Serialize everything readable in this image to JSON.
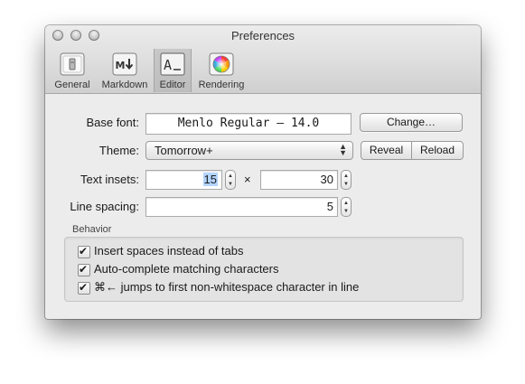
{
  "window": {
    "title": "Preferences"
  },
  "toolbar": {
    "tabs": [
      {
        "label": "General",
        "icon": "switch-icon"
      },
      {
        "label": "Markdown",
        "icon": "markdown-icon"
      },
      {
        "label": "Editor",
        "icon": "editor-icon",
        "active": true
      },
      {
        "label": "Rendering",
        "icon": "color-wheel-icon"
      }
    ]
  },
  "editor": {
    "base_font": {
      "label": "Base font:",
      "value": "Menlo Regular – 14.0",
      "change_button": "Change…"
    },
    "theme": {
      "label": "Theme:",
      "value": "Tomorrow+",
      "reveal_button": "Reveal",
      "reload_button": "Reload"
    },
    "text_insets": {
      "label": "Text insets:",
      "horizontal": "15",
      "separator": "×",
      "vertical": "30"
    },
    "line_spacing": {
      "label": "Line spacing:",
      "value": "5"
    },
    "behavior": {
      "title": "Behavior",
      "options": [
        {
          "label": "Insert spaces instead of tabs",
          "checked": true
        },
        {
          "label": "Auto-complete matching characters",
          "checked": true
        },
        {
          "label": "⌘← jumps to first non-whitespace character in line",
          "checked": true
        }
      ]
    }
  },
  "colors": {
    "selection": "#b3d4fd",
    "window_bg": "#ececec"
  }
}
